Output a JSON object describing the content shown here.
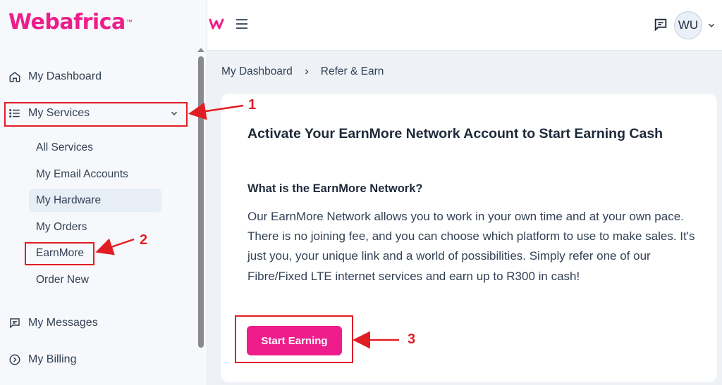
{
  "brand": {
    "logo_text": "Webafrica",
    "logo_tm": "™",
    "mini_logo": "ᴡ",
    "color": "#ee1d8b"
  },
  "sidebar": {
    "items": [
      {
        "label": "My Dashboard",
        "icon": "home-icon"
      },
      {
        "label": "My Services",
        "icon": "list-icon"
      },
      {
        "label": "My Messages",
        "icon": "message-icon"
      },
      {
        "label": "My Billing",
        "icon": "chevron-circle-icon"
      }
    ],
    "services_submenu": [
      "All Services",
      "My Email Accounts",
      "My Hardware",
      "My Orders",
      "EarnMore",
      "Order New"
    ]
  },
  "header": {
    "avatar_initials": "WU"
  },
  "breadcrumb": [
    "My Dashboard",
    "Refer & Earn"
  ],
  "card": {
    "title": "Activate Your EarnMore Network Account to Start Earning Cash",
    "subtitle": "What is the EarnMore Network?",
    "body": "Our EarnMore Network allows you to work in your own time and at your own pace. There is no joining fee, and you can choose which platform to use to make sales. It's just you, your unique link and a world of possibilities. Simply refer one of our Fibre/Fixed LTE internet services and earn up to R300 in cash!",
    "button_label": "Start Earning"
  },
  "annotations": [
    "1",
    "2",
    "3"
  ],
  "colors": {
    "accent": "#ee1d8b",
    "annotation": "#e11d24"
  }
}
